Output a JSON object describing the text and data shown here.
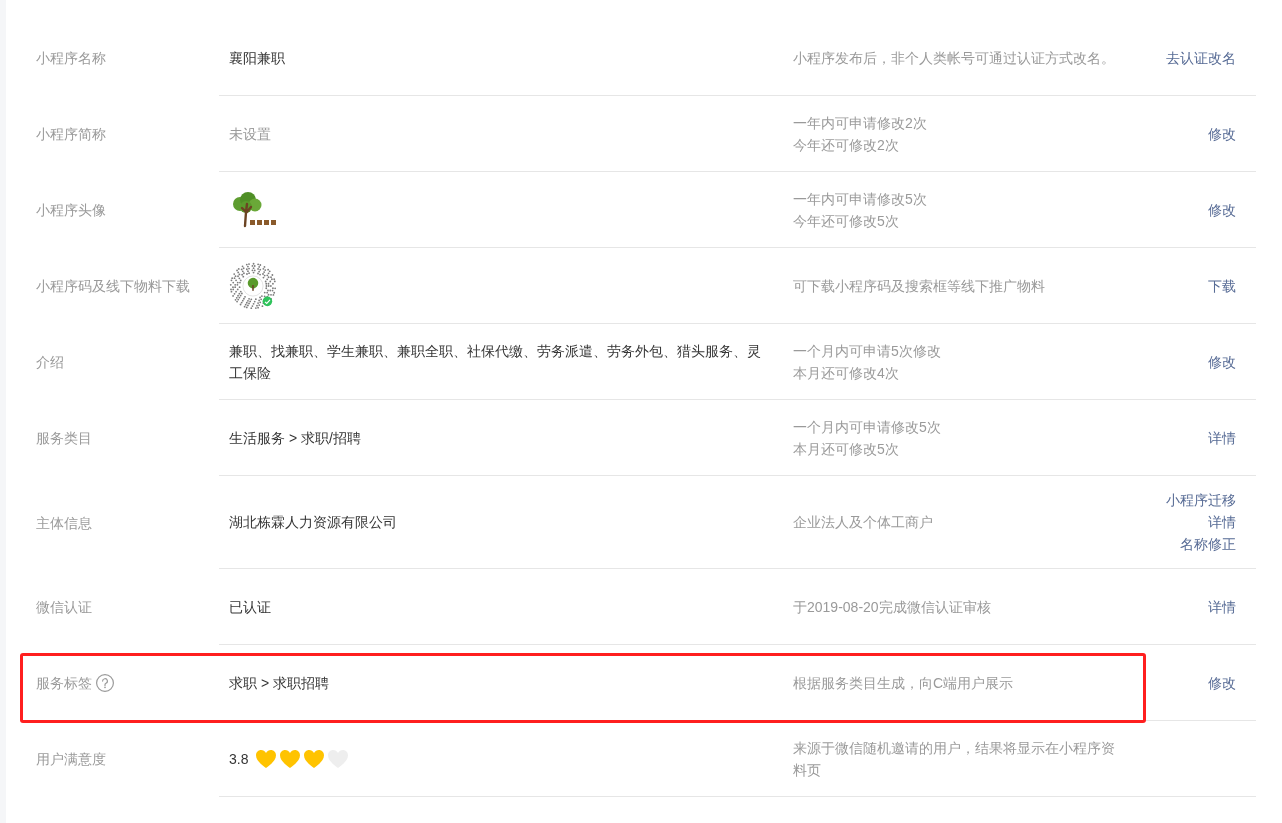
{
  "rows": [
    {
      "label": "小程序名称",
      "help": false,
      "highlighted": false,
      "value": {
        "kind": "text",
        "text": "襄阳兼职",
        "muted": false
      },
      "notes": [
        "小程序发布后，非个人类帐号可通过认证方式改名。"
      ],
      "actions": [
        "去认证改名"
      ]
    },
    {
      "label": "小程序简称",
      "help": false,
      "highlighted": false,
      "value": {
        "kind": "text",
        "text": "未设置",
        "muted": true
      },
      "notes": [
        "一年内可申请修改2次",
        "今年还可修改2次"
      ],
      "actions": [
        "修改"
      ]
    },
    {
      "label": "小程序头像",
      "help": false,
      "highlighted": false,
      "value": {
        "kind": "avatar"
      },
      "notes": [
        "一年内可申请修改5次",
        "今年还可修改5次"
      ],
      "actions": [
        "修改"
      ]
    },
    {
      "label": "小程序码及线下物料下载",
      "help": false,
      "highlighted": false,
      "value": {
        "kind": "code"
      },
      "notes": [
        "可下载小程序码及搜索框等线下推广物料"
      ],
      "actions": [
        "下载"
      ]
    },
    {
      "label": "介绍",
      "help": false,
      "highlighted": false,
      "value": {
        "kind": "text",
        "text": "兼职、找兼职、学生兼职、兼职全职、社保代缴、劳务派遣、劳务外包、猎头服务、灵工保险",
        "muted": false
      },
      "notes": [
        "一个月内可申请5次修改",
        "本月还可修改4次"
      ],
      "actions": [
        "修改"
      ]
    },
    {
      "label": "服务类目",
      "help": false,
      "highlighted": false,
      "value": {
        "kind": "text",
        "text": "生活服务 > 求职/招聘",
        "muted": false
      },
      "notes": [
        "一个月内可申请修改5次",
        "本月还可修改5次"
      ],
      "actions": [
        "详情"
      ]
    },
    {
      "label": "主体信息",
      "help": false,
      "highlighted": false,
      "value": {
        "kind": "text",
        "text": "湖北栋霖人力资源有限公司",
        "muted": false
      },
      "notes": [
        "企业法人及个体工商户"
      ],
      "actions": [
        "小程序迁移",
        "详情",
        "名称修正"
      ]
    },
    {
      "label": "微信认证",
      "help": false,
      "highlighted": false,
      "value": {
        "kind": "text",
        "text": "已认证",
        "muted": false
      },
      "notes": [
        "于2019-08-20完成微信认证审核"
      ],
      "actions": [
        "详情"
      ]
    },
    {
      "label": "服务标签",
      "help": true,
      "highlighted": true,
      "value": {
        "kind": "text",
        "text": "求职 > 求职招聘",
        "muted": false
      },
      "notes": [
        "根据服务类目生成，向C端用户展示"
      ],
      "actions": [
        "修改"
      ]
    },
    {
      "label": "用户满意度",
      "help": false,
      "highlighted": false,
      "value": {
        "kind": "rating",
        "score": "3.8",
        "stars": 3
      },
      "notes": [
        "来源于微信随机邀请的用户，结果将显示在小程序资料页"
      ]
    }
  ]
}
